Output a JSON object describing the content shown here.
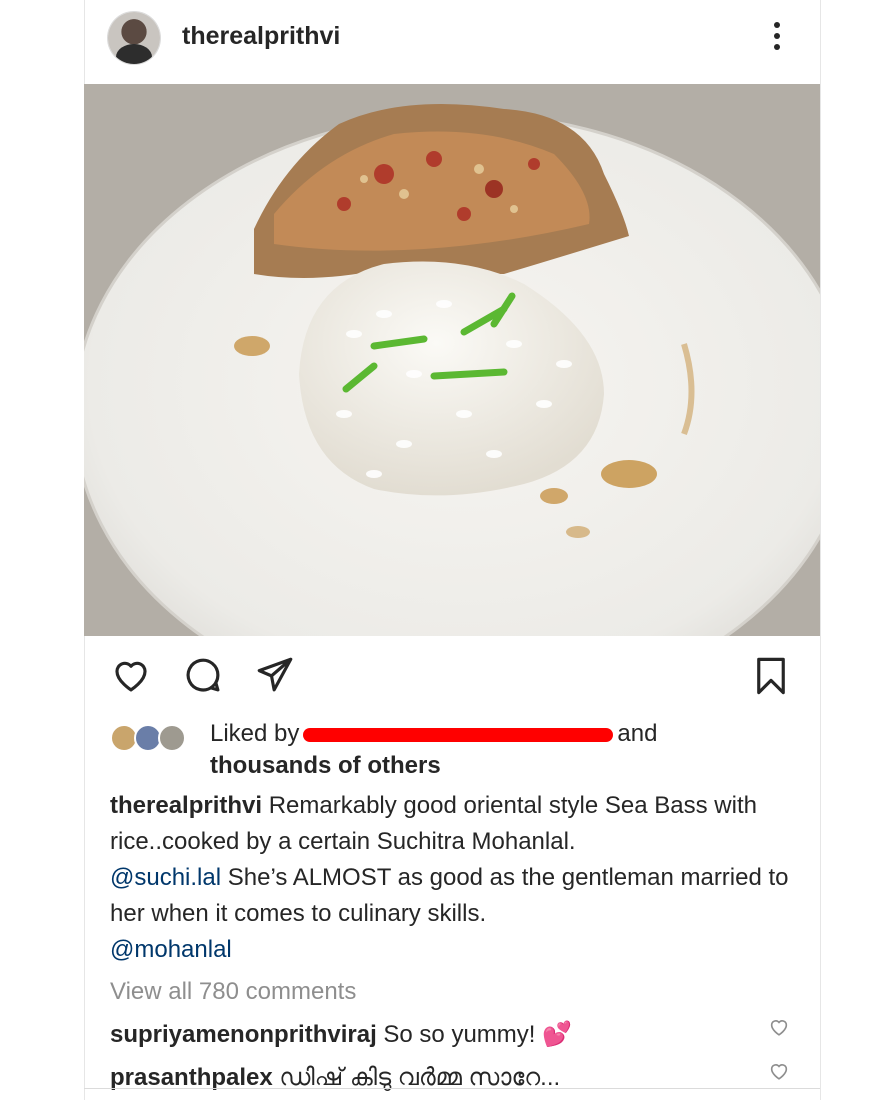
{
  "post": {
    "username": "therealprithvi",
    "more_icon": "more-vertical-icon"
  },
  "actions": {
    "like_icon": "heart-outline-icon",
    "comment_icon": "comment-icon",
    "share_icon": "send-icon",
    "save_icon": "bookmark-icon"
  },
  "likes": {
    "prefix": "Liked by",
    "suffix": "and",
    "others": "thousands of others"
  },
  "caption": {
    "username": "therealprithvi",
    "text1": " Remarkably good oriental style Sea Bass with rice..cooked by a certain Suchitra Mohanlal.",
    "mention1": "@suchi.lal",
    "text2": " She’s ALMOST as good as the gentleman married to her when it comes to culinary skills.",
    "mention2": "@mohanlal"
  },
  "view_all_comments": "View all 780 comments",
  "comments": [
    {
      "username": "supriyamenonprithviraj",
      "text": " So so yummy! 💕"
    },
    {
      "username": "prasanthpalex",
      "text": " ഡിഷ് കിടു വർമ്മ സാറേ..."
    }
  ],
  "colors": {
    "text": "#262626",
    "mention": "#00376b",
    "muted": "#8e8e8e",
    "redaction": "#ff0000"
  }
}
